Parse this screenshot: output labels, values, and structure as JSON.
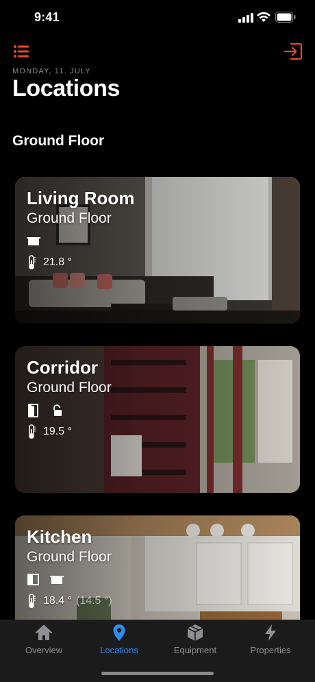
{
  "status_bar": {
    "time": "9:41"
  },
  "header": {
    "date": "MONDAY, 11. JULY",
    "title": "Locations",
    "menu_icon": "list-icon",
    "logout_icon": "logout-icon",
    "accent_color": "#e8472f"
  },
  "section": {
    "title": "Ground Floor"
  },
  "cards": [
    {
      "name": "Living Room",
      "floor": "Ground Floor",
      "devices": [
        "blind-icon"
      ],
      "temperature": "21.8 °",
      "target": ""
    },
    {
      "name": "Corridor",
      "floor": "Ground Floor",
      "devices": [
        "door-icon",
        "unlocked-icon"
      ],
      "temperature": "19.5 °",
      "target": ""
    },
    {
      "name": "Kitchen",
      "floor": "Ground Floor",
      "devices": [
        "window-icon",
        "blind-icon"
      ],
      "temperature": "18.4 °",
      "target": "(14.5 °)"
    }
  ],
  "tabs": [
    {
      "label": "Overview",
      "icon": "house-icon",
      "active": false
    },
    {
      "label": "Locations",
      "icon": "location-pin-icon",
      "active": true
    },
    {
      "label": "Equipment",
      "icon": "box-icon",
      "active": false
    },
    {
      "label": "Properties",
      "icon": "bolt-icon",
      "active": false
    }
  ],
  "colors": {
    "active_tab": "#2f8cf0",
    "inactive_tab": "#8e8e93",
    "tab_bar_bg": "#1b1b1b"
  }
}
